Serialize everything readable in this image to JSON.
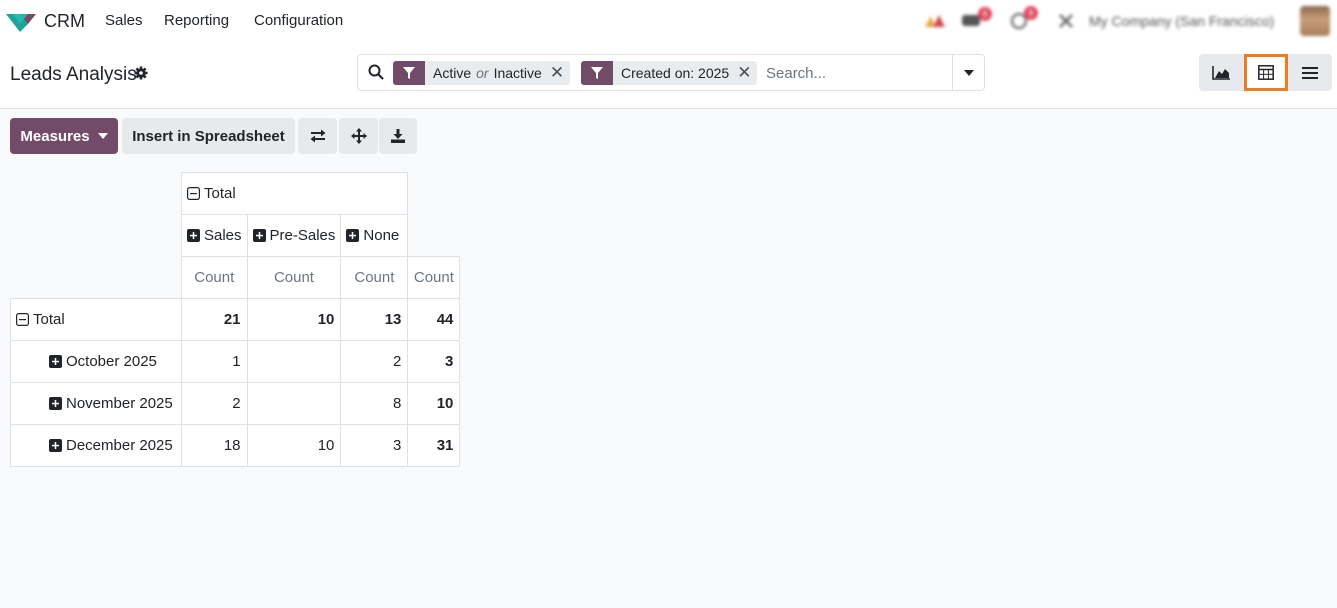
{
  "navbar": {
    "app_name": "CRM",
    "menus": [
      "Sales",
      "Reporting",
      "Configuration"
    ],
    "company": "My Company (San Francisco)",
    "activity_count": "8",
    "messages_count": "8"
  },
  "control_panel": {
    "title": "Leads Analysis",
    "facets": [
      {
        "value_a": "Active",
        "or": "or",
        "value_b": "Inactive"
      },
      {
        "value": "Created on: 2025"
      }
    ],
    "search_placeholder": "Search..."
  },
  "toolbar": {
    "measures_label": "Measures",
    "insert_label": "Insert in Spreadsheet"
  },
  "pivot": {
    "col_group": "Total",
    "columns": [
      "Sales",
      "Pre-Sales",
      "None"
    ],
    "measure": "Count",
    "total_row": {
      "label": "Total",
      "values": [
        "21",
        "10",
        "13",
        "44"
      ]
    },
    "rows": [
      {
        "label": "October 2025",
        "values": [
          "1",
          "",
          "2",
          "3"
        ]
      },
      {
        "label": "November 2025",
        "values": [
          "2",
          "",
          "8",
          "10"
        ]
      },
      {
        "label": "December 2025",
        "values": [
          "18",
          "10",
          "3",
          "31"
        ]
      }
    ]
  },
  "colors": {
    "primary": "#714b67",
    "active_view_highlight": "#f07a22",
    "logo_green": "#1ba39c",
    "logo_purple": "#714b67"
  }
}
